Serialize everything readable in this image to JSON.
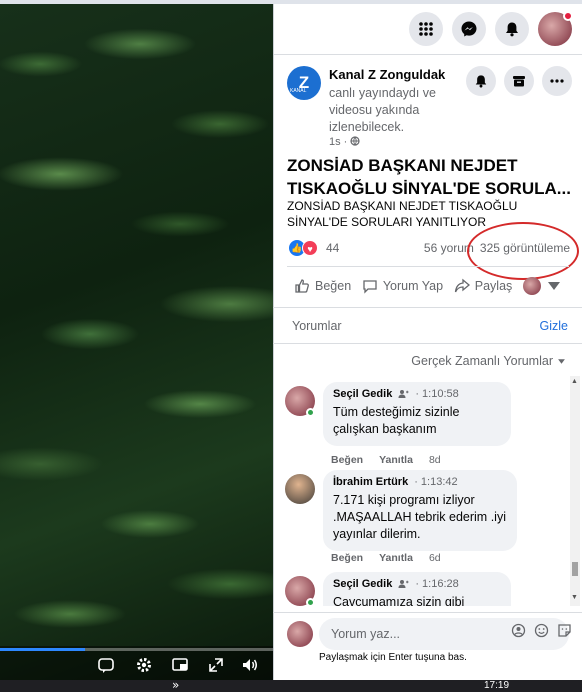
{
  "taskbar": {
    "arrow": "»",
    "time": "17:19"
  },
  "video": {
    "progress_fraction": 0.31
  },
  "post": {
    "page_name": "Kanal Z Zonguldak",
    "logo_text": "Z",
    "logo_small": "KANAL",
    "subtitle": "canlı yayındaydı ve videosu yakında izlenebilecek.",
    "time": "1s · ",
    "title": "ZONSİAD BAŞKANI NEJDET TISKAOĞLU SİNYAL'DE SORULA...",
    "description": "ZONSİAD BAŞKANI NEJDET TISKAOĞLU SİNYAL'DE SORULARI YANITLIYOR",
    "reaction_count": "44",
    "comments_count": "56 yorum",
    "views_count": "325 görüntüleme"
  },
  "actions": {
    "like": "Beğen",
    "comment": "Yorum Yap",
    "share": "Paylaş"
  },
  "comments_section": {
    "header": "Yorumlar",
    "hide": "Gizle",
    "sort": "Gerçek Zamanlı Yorumlar",
    "items": [
      {
        "name": "Seçil Gedik",
        "time": "1:10:58",
        "text": "Tüm desteğimiz sizinle çalışkan başkanım",
        "like": "Beğen",
        "reply": "Yanıtla",
        "age": "8d"
      },
      {
        "name": "İbrahim Ertürk",
        "time": "1:13:42",
        "text": "7.171 kişi programı izliyor .MAŞAALLAH tebrik ederim .iyi yayınlar dilerim.",
        "like": "Beğen",
        "reply": "Yanıtla",
        "age": "6d"
      },
      {
        "name": "Seçil Gedik",
        "time": "1:16:28",
        "text": "Cavcumamıza sizin gibi çalışan"
      }
    ]
  },
  "composer": {
    "placeholder": "Yorum yaz...",
    "hint": "Paylaşmak için Enter tuşuna bas."
  }
}
